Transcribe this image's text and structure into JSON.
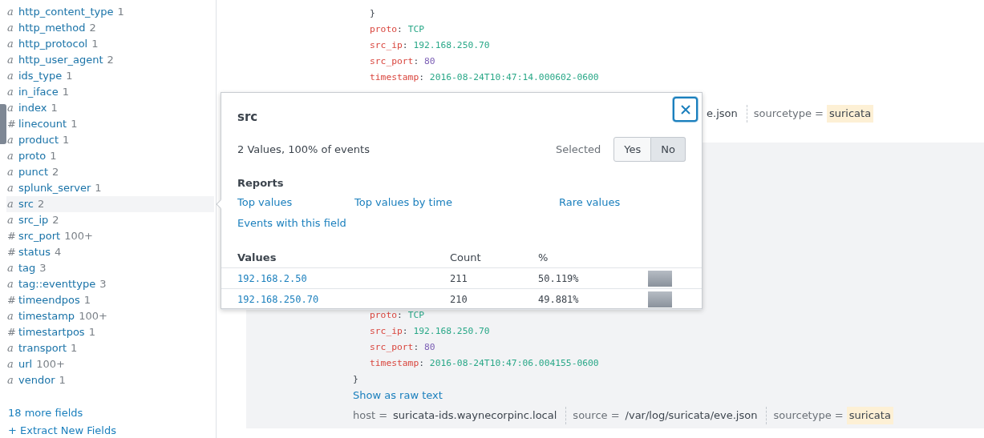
{
  "sidebar": {
    "fields": [
      {
        "type": "a",
        "name": "http_content_type",
        "count": "1",
        "selected": false
      },
      {
        "type": "a",
        "name": "http_method",
        "count": "2",
        "selected": false
      },
      {
        "type": "a",
        "name": "http_protocol",
        "count": "1",
        "selected": false
      },
      {
        "type": "a",
        "name": "http_user_agent",
        "count": "2",
        "selected": false
      },
      {
        "type": "a",
        "name": "ids_type",
        "count": "1",
        "selected": false
      },
      {
        "type": "a",
        "name": "in_iface",
        "count": "1",
        "selected": false
      },
      {
        "type": "a",
        "name": "index",
        "count": "1",
        "selected": false
      },
      {
        "type": "#",
        "name": "linecount",
        "count": "1",
        "selected": false
      },
      {
        "type": "a",
        "name": "product",
        "count": "1",
        "selected": false
      },
      {
        "type": "a",
        "name": "proto",
        "count": "1",
        "selected": false
      },
      {
        "type": "a",
        "name": "punct",
        "count": "2",
        "selected": false
      },
      {
        "type": "a",
        "name": "splunk_server",
        "count": "1",
        "selected": false
      },
      {
        "type": "a",
        "name": "src",
        "count": "2",
        "selected": true
      },
      {
        "type": "a",
        "name": "src_ip",
        "count": "2",
        "selected": false
      },
      {
        "type": "#",
        "name": "src_port",
        "count": "100+",
        "selected": false
      },
      {
        "type": "#",
        "name": "status",
        "count": "4",
        "selected": false
      },
      {
        "type": "a",
        "name": "tag",
        "count": "3",
        "selected": false
      },
      {
        "type": "a",
        "name": "tag::eventtype",
        "count": "3",
        "selected": false
      },
      {
        "type": "#",
        "name": "timeendpos",
        "count": "1",
        "selected": false
      },
      {
        "type": "a",
        "name": "timestamp",
        "count": "100+",
        "selected": false
      },
      {
        "type": "#",
        "name": "timestartpos",
        "count": "1",
        "selected": false
      },
      {
        "type": "a",
        "name": "transport",
        "count": "1",
        "selected": false
      },
      {
        "type": "a",
        "name": "url",
        "count": "100+",
        "selected": false
      },
      {
        "type": "a",
        "name": "vendor",
        "count": "1",
        "selected": false
      }
    ],
    "more_fields": "18 more fields",
    "extract": "+ Extract New Fields"
  },
  "events": [
    {
      "lines": [
        {
          "kind": "close",
          "text": "}"
        },
        {
          "kind": "string",
          "key": "proto",
          "sep": ":",
          "value": "TCP"
        },
        {
          "kind": "string",
          "key": "src_ip",
          "sep": ":",
          "value": "192.168.250.70"
        },
        {
          "kind": "number",
          "key": "src_port",
          "sep": ":",
          "value": "80"
        },
        {
          "kind": "string",
          "key": "timestamp",
          "sep": ":",
          "value": "2016-08-24T10:47:14.000602-0600"
        }
      ],
      "meta": [
        {
          "value": "e.json",
          "highlight": false
        },
        {
          "key": "sourcetype =",
          "value": "suricata",
          "highlight": true
        }
      ]
    },
    {
      "lines": [
        {
          "kind": "string",
          "key": "proto",
          "sep": ":",
          "value": "TCP"
        },
        {
          "kind": "string",
          "key": "src_ip",
          "sep": ":",
          "value": "192.168.250.70"
        },
        {
          "kind": "number",
          "key": "src_port",
          "sep": ":",
          "value": "80"
        },
        {
          "kind": "string",
          "key": "timestamp",
          "sep": ":",
          "value": "2016-08-24T10:47:06.004155-0600"
        },
        {
          "kind": "end",
          "text": "}"
        }
      ],
      "raw_link": "Show as raw text",
      "meta": [
        {
          "key": "host =",
          "value": "suricata-ids.waynecorpinc.local",
          "highlight": false
        },
        {
          "key": "source =",
          "value": "/var/log/suricata/eve.json",
          "highlight": false
        },
        {
          "key": "sourcetype =",
          "value": "suricata",
          "highlight": true
        }
      ]
    }
  ],
  "popover": {
    "title": "src",
    "summary": "2 Values, 100% of events",
    "selected_label": "Selected",
    "options": [
      {
        "label": "Yes",
        "selected": false
      },
      {
        "label": "No",
        "selected": true
      }
    ],
    "reports_title": "Reports",
    "reports": [
      "Top values",
      "Top values by time",
      "Rare values",
      "Events with this field"
    ],
    "columns": [
      "Values",
      "Count",
      "%"
    ],
    "rows": [
      {
        "value": "192.168.2.50",
        "count": "211",
        "percent": "50.119%"
      },
      {
        "value": "192.168.250.70",
        "count": "210",
        "percent": "49.881%"
      }
    ]
  }
}
